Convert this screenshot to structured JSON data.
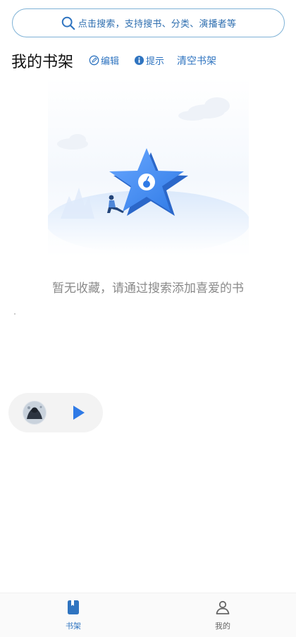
{
  "search": {
    "placeholder": "点击搜索，支持搜书、分类、演播者等",
    "icon": "search-icon"
  },
  "header": {
    "title": "我的书架",
    "edit_label": "编辑",
    "tips_label": "提示",
    "clear_label": "清空书架"
  },
  "empty_state": {
    "message": "暂无收藏，请通过搜索添加喜爱的书"
  },
  "player": {
    "play_icon": "play-icon"
  },
  "bottom_nav": {
    "items": [
      {
        "label": "书架",
        "icon": "bookshelf-icon",
        "active": true
      },
      {
        "label": "我的",
        "icon": "person-icon",
        "active": false
      }
    ]
  },
  "colors": {
    "accent": "#2f74c0",
    "search_border": "#7fb2d6",
    "nav_active": "#2f74c0",
    "nav_inactive": "#666666",
    "empty_text": "#8a8a8a"
  }
}
